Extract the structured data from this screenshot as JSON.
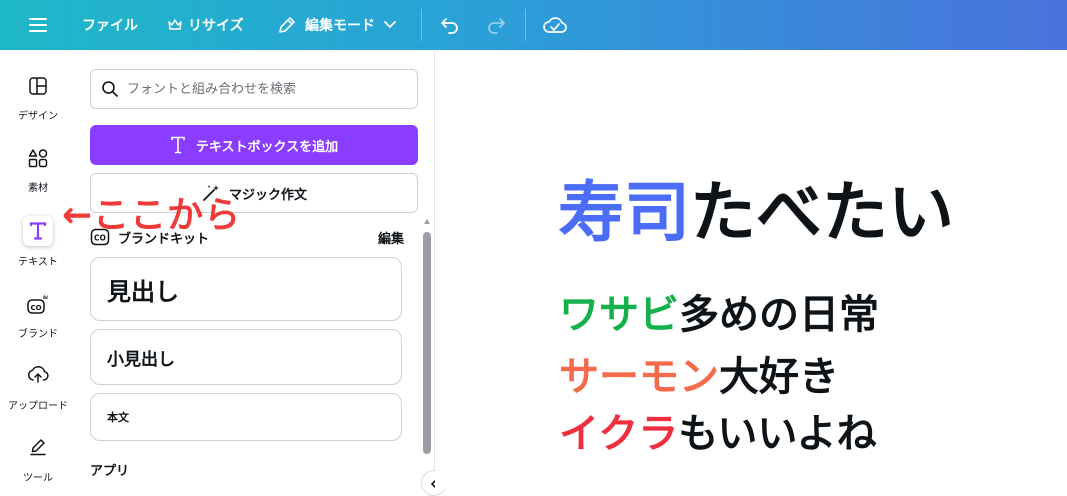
{
  "topbar": {
    "file": "ファイル",
    "resize": "リサイズ",
    "edit_mode": "編集モード"
  },
  "rail": {
    "items": [
      {
        "label": "デザイン",
        "icon": "layout-icon"
      },
      {
        "label": "素材",
        "icon": "shapes-icon"
      },
      {
        "label": "テキスト",
        "icon": "text-icon"
      },
      {
        "label": "ブランド",
        "icon": "brand-icon"
      },
      {
        "label": "アップロード",
        "icon": "upload-cloud-icon"
      },
      {
        "label": "ツール",
        "icon": "pen-tool-icon"
      }
    ],
    "active_index": 2
  },
  "panel": {
    "search_placeholder": "フォントと組み合わせを検索",
    "add_textbox": "テキストボックスを追加",
    "magic_write": "マジック作文",
    "brand_kit": "ブランドキット",
    "brand_edit": "編集",
    "styles": [
      {
        "label": "見出し"
      },
      {
        "label": "小見出し"
      },
      {
        "label": "本文"
      }
    ],
    "apps": "アプリ"
  },
  "annotation": {
    "text": "←ここから",
    "color": "#f03a3a"
  },
  "canvas": {
    "lines": [
      {
        "accent": "寿司",
        "rest": "たべたい",
        "accent_color": "#4a6cf7"
      },
      {
        "accent": "ワサビ",
        "rest": "多めの日常",
        "accent_color": "#13b04c"
      },
      {
        "accent": "サーモン",
        "rest": "大好き",
        "accent_color": "#f56a4a"
      },
      {
        "accent": "イクラ",
        "rest": "もいいよね",
        "accent_color": "#ef2f3f"
      }
    ]
  },
  "colors": {
    "primary_button": "#8b3dff",
    "topbar_gradient_start": "#1fb8c8",
    "topbar_gradient_end": "#4a72dc"
  }
}
